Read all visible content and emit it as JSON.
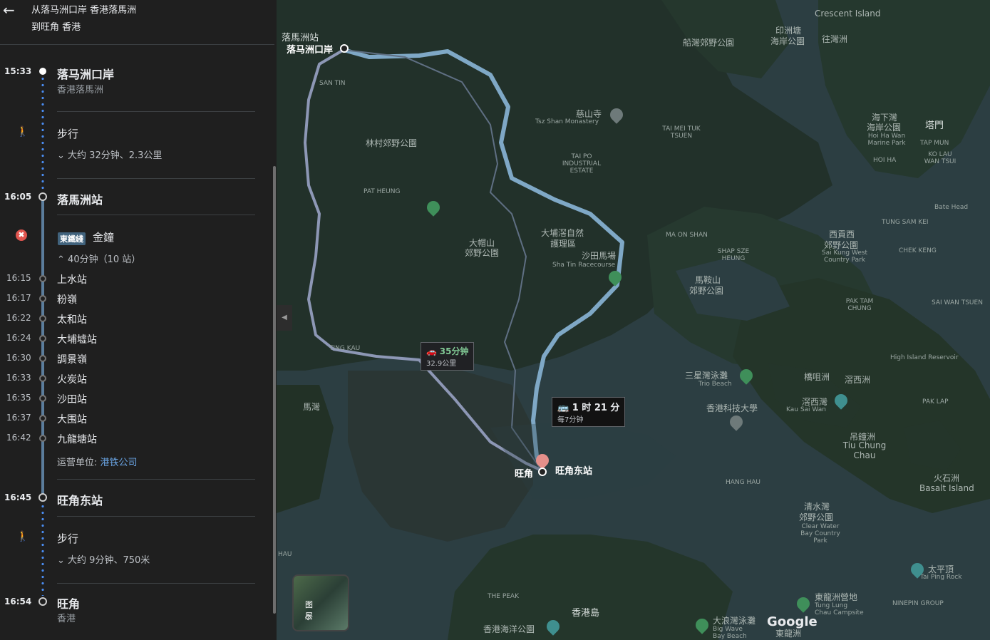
{
  "header": {
    "from_prefix": "从",
    "from_place": "落马洲口岸 香港落馬洲",
    "to_prefix": "到",
    "to_place": "旺角 香港"
  },
  "trip": {
    "start": {
      "time": "15:33",
      "name": "落马洲口岸",
      "sub": "香港落馬洲"
    },
    "walk1": {
      "label": "步行",
      "detail": "大约 32分钟、2.3公里"
    },
    "station1": {
      "time": "16:05",
      "name": "落馬洲站"
    },
    "train": {
      "line_badge": "東鐵綫",
      "direction": "金鐘",
      "detail": "40分钟（10 站）",
      "operator_label": "运营单位:",
      "operator": "港铁公司"
    },
    "stops": [
      {
        "time": "16:15",
        "name": "上水站"
      },
      {
        "time": "16:17",
        "name": "粉嶺"
      },
      {
        "time": "16:22",
        "name": "太和站"
      },
      {
        "time": "16:24",
        "name": "大埔墟站"
      },
      {
        "time": "16:30",
        "name": "調景嶺"
      },
      {
        "time": "16:33",
        "name": "火炭站"
      },
      {
        "time": "16:35",
        "name": "沙田站"
      },
      {
        "time": "16:37",
        "name": "大围站"
      },
      {
        "time": "16:42",
        "name": "九龍塘站"
      }
    ],
    "station2": {
      "time": "16:45",
      "name": "旺角东站"
    },
    "walk2": {
      "label": "步行",
      "detail": "大约 9分钟、750米"
    },
    "end": {
      "time": "16:54",
      "name": "旺角",
      "sub": "香港"
    }
  },
  "map": {
    "car_callout": {
      "duration": "35分钟",
      "distance": "32.9公里"
    },
    "transit_callout": {
      "duration": "1 时 21 分",
      "freq": "每7分钟"
    },
    "layers_label": "图层",
    "labels": {
      "crescent": "Crescent Island",
      "lmc_station": "落馬洲站",
      "lmc_port": "落马洲口岸",
      "ship_park": "船灣郊野公園",
      "yingtong": "印洲塘",
      "yingtong2": "海岸公園",
      "wong": "往灣洲",
      "tsz_shan": "慈山寺",
      "tsz_shan_en": "Tsz Shan Monastery",
      "lamtsuen": "林村郊野公園",
      "tai_mei_tuk": "TAI MEI TUK TSUEN",
      "tai_po_ie": "TAI PO INDUSTRIAL ESTATE",
      "pat_heung": "PAT HEUNG",
      "san_tin": "SAN TIN",
      "tai_mo": "大帽山",
      "tai_mo2": "郊野公園",
      "tai_po_kau": "大埔滘自然",
      "tai_po_kau2": "護理區",
      "racecourse": "沙田馬場",
      "racecourse_en": "Sha Tin Racecourse",
      "ma_on_shan": "MA ON SHAN",
      "shap_sze": "SHAP SZE HEUNG",
      "ma_on_shan_park": "馬鞍山",
      "ma_on_shan_park2": "郊野公園",
      "sai_kung_w": "西貢西",
      "sai_kung_w2": "郊野公園",
      "sai_kung_w_en": "Sai Kung West Country Park",
      "hoi_ha": "海下灣",
      "hoi_ha2": "海岸公園",
      "hoi_ha_en": "Hoi Ha Wan Marine Park",
      "tap_mun": "塔門",
      "tap_mun_en": "TAP MUN",
      "ko_lau": "KO LAU WAN TSUI",
      "hoi_ha_v": "HOI HA",
      "bate": "Bate Head",
      "tung_sam": "TUNG SAM KEI",
      "chek_keng": "CHEK KENG",
      "pak_tam": "PAK TAM CHUNG",
      "sai_wan": "SAI WAN TSUEN",
      "high_island": "High Island Reservoir",
      "tsing_kau": "TING KAU",
      "ma_wan": "馬灣",
      "trio": "三星灣泳灘",
      "trio_en": "Trio Beach",
      "hkust": "香港科技大學",
      "kiu_tsui": "橋咀洲",
      "sharp": "滘西洲",
      "kau_sai_wan": "滘西灣",
      "kau_sai_en": "Kau Sai Wan",
      "pak_lap": "PAK LAP",
      "tiu_chung": "吊鐘洲",
      "tiu_chung_en": "Tiu Chung Chau",
      "basalt": "火石洲",
      "basalt_en": "Basalt Island",
      "clear_water": "清水灣",
      "clear_water2": "郊野公園",
      "clear_water_en": "Clear Water Bay Country Park",
      "mongkok": "旺角",
      "mk_east": "旺角东站",
      "hang_hau": "HANG HAU",
      "the_peak": "THE PEAK",
      "hk_island": "香港島",
      "ocean_park": "香港海洋公園",
      "big_wave": "大浪灣泳灘",
      "big_wave_en": "Big Wave Bay Beach",
      "tung_lung": "東龍洲營地",
      "tung_lung_en": "Tung Lung Chau Campsite",
      "tung_lung2": "東龍洲",
      "ninepin": "NINEPIN GROUP",
      "tai_ping": "太平頂",
      "tai_ping_en": "Tai Ping Rock",
      "hau": "HAU",
      "google": "Google"
    }
  },
  "colors": {
    "route_main": "#7fa8c6",
    "route_alt": "#8d97b5",
    "transit_dot": "#4a8cf0",
    "water": "#2c3e42",
    "land": "#22312a"
  }
}
